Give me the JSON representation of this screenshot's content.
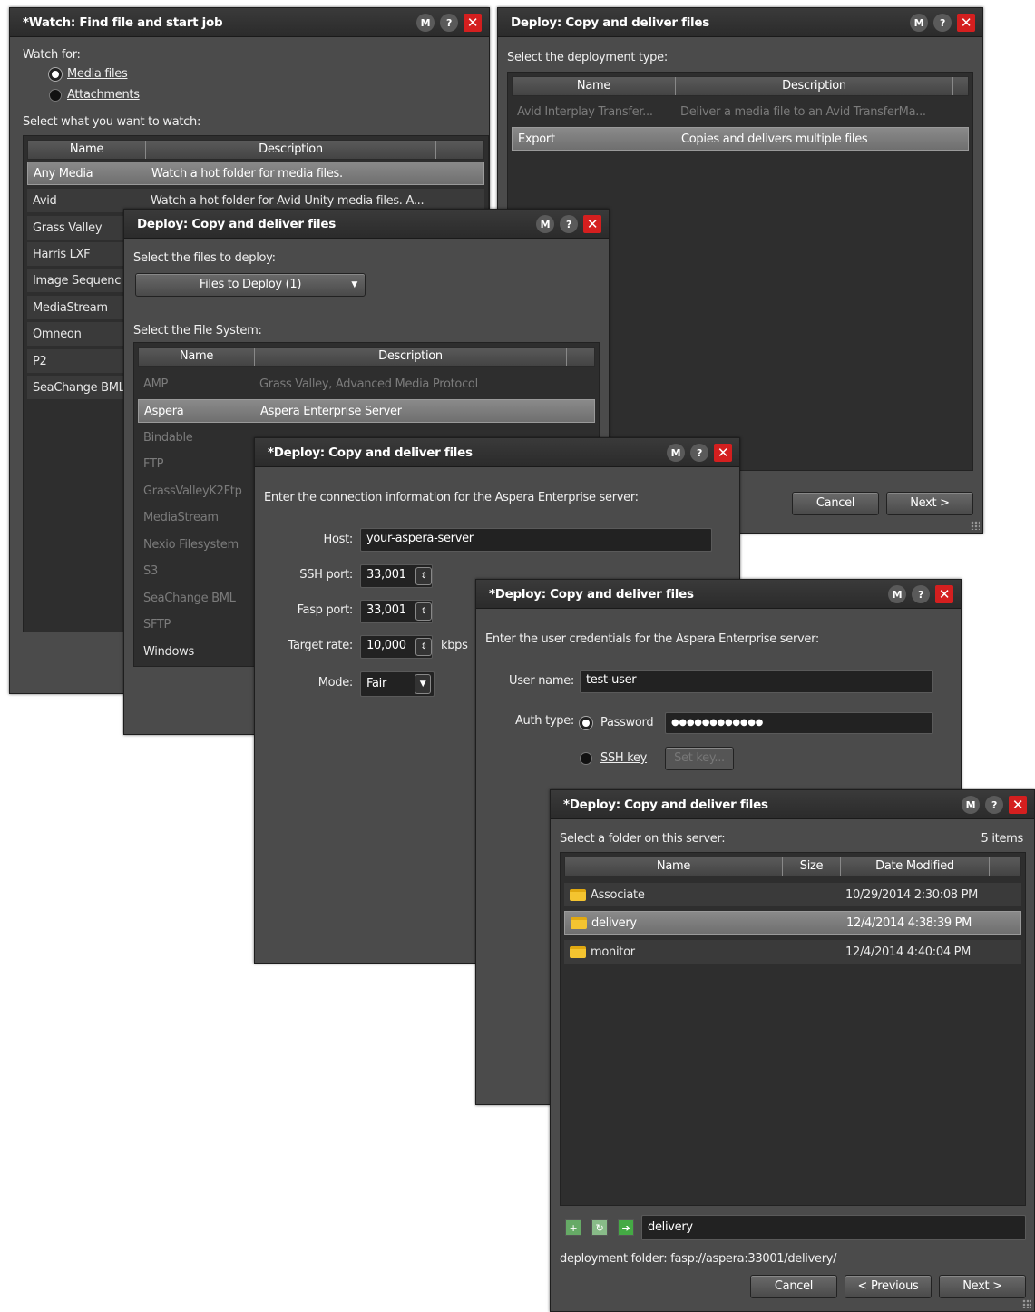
{
  "win1": {
    "title": "*Watch: Find file and start job",
    "watch_for": "Watch for:",
    "opt_media": "Media files",
    "opt_attach": "Attachments",
    "select_label": "Select what you want to watch:",
    "col_name": "Name",
    "col_desc": "Description",
    "rows": [
      {
        "name": "Any Media",
        "desc": "Watch a hot folder for media files."
      },
      {
        "name": "Avid",
        "desc": "Watch a hot folder for Avid Unity media files. A..."
      },
      {
        "name": "Grass Valley",
        "desc": ""
      },
      {
        "name": "Harris LXF",
        "desc": ""
      },
      {
        "name": "Image Sequenc",
        "desc": ""
      },
      {
        "name": "MediaStream",
        "desc": ""
      },
      {
        "name": "Omneon",
        "desc": ""
      },
      {
        "name": "P2",
        "desc": ""
      },
      {
        "name": "SeaChange BML",
        "desc": ""
      }
    ]
  },
  "win2": {
    "title": "Deploy: Copy and deliver files",
    "select_label": "Select the deployment type:",
    "col_name": "Name",
    "col_desc": "Description",
    "rows": [
      {
        "name": "Avid Interplay Transfer...",
        "desc": "Deliver a media file to an Avid TransferMa..."
      },
      {
        "name": "Export",
        "desc": "Copies and delivers multiple files"
      }
    ],
    "cancel": "Cancel",
    "next": "Next >"
  },
  "win3": {
    "title": "Deploy: Copy and deliver files",
    "files_label": "Select the files to deploy:",
    "files_dropdown": "Files to Deploy (1)",
    "fs_label": "Select the File System:",
    "col_name": "Name",
    "col_desc": "Description",
    "rows": [
      {
        "name": "AMP",
        "desc": "Grass Valley, Advanced Media Protocol"
      },
      {
        "name": "Aspera",
        "desc": "Aspera Enterprise Server"
      },
      {
        "name": "Bindable",
        "desc": ""
      },
      {
        "name": "FTP",
        "desc": ""
      },
      {
        "name": "GrassValleyK2Ftp",
        "desc": ""
      },
      {
        "name": "MediaStream",
        "desc": ""
      },
      {
        "name": "Nexio Filesystem",
        "desc": ""
      },
      {
        "name": "S3",
        "desc": ""
      },
      {
        "name": "SeaChange BML",
        "desc": ""
      },
      {
        "name": "SFTP",
        "desc": ""
      },
      {
        "name": "Windows",
        "desc": ""
      }
    ]
  },
  "win4": {
    "title": "*Deploy: Copy and deliver files",
    "intro": "Enter the connection information for the Aspera Enterprise server:",
    "host_label": "Host:",
    "host_value": "your-aspera-server",
    "ssh_label": "SSH port:",
    "ssh_value": "33,001",
    "fasp_label": "Fasp port:",
    "fasp_value": "33,001",
    "rate_label": "Target rate:",
    "rate_value": "10,000",
    "rate_unit": "kbps",
    "mode_label": "Mode:",
    "mode_value": "Fair"
  },
  "win5": {
    "title": "*Deploy: Copy and deliver files",
    "intro": "Enter the user credentials for the Aspera Enterprise server:",
    "user_label": "User name:",
    "user_value": "test-user",
    "auth_label": "Auth type:",
    "opt_password": "Password",
    "password_value": "●●●●●●●●●●●●",
    "opt_sshkey": "SSH key",
    "setkey": "Set key..."
  },
  "win6": {
    "title": "*Deploy: Copy and deliver files",
    "select_label": "Select a folder on this server:",
    "count": "5 items",
    "col_name": "Name",
    "col_size": "Size",
    "col_date": "Date Modified",
    "rows": [
      {
        "name": "Associate",
        "size": "",
        "date": "10/29/2014 2:30:08 PM"
      },
      {
        "name": "delivery",
        "size": "",
        "date": "12/4/2014 4:38:39 PM"
      },
      {
        "name": "monitor",
        "size": "",
        "date": "12/4/2014 4:40:04 PM"
      }
    ],
    "path_value": "delivery",
    "deploy_folder": "deployment folder: fasp://aspera:33001/delivery/",
    "cancel": "Cancel",
    "previous": "< Previous",
    "next": "Next >"
  },
  "common": {
    "m": "M",
    "help": "?",
    "close": "✕"
  }
}
